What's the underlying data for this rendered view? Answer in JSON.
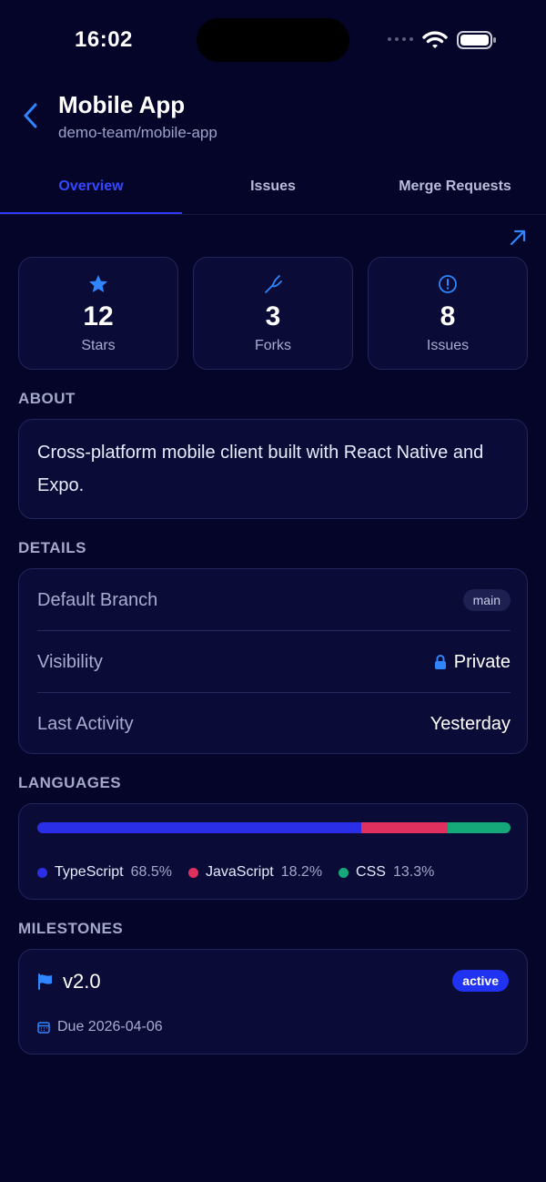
{
  "status_bar": {
    "time": "16:02"
  },
  "header": {
    "title": "Mobile App",
    "subtitle": "demo-team/mobile-app",
    "back_icon": "chevron-left-icon"
  },
  "tabs": [
    {
      "label": "Overview",
      "active": true
    },
    {
      "label": "Issues",
      "active": false
    },
    {
      "label": "Merge Requests",
      "active": false
    }
  ],
  "stats": [
    {
      "icon": "star-icon",
      "value": "12",
      "label": "Stars"
    },
    {
      "icon": "fork-icon",
      "value": "3",
      "label": "Forks"
    },
    {
      "icon": "issue-icon",
      "value": "8",
      "label": "Issues"
    }
  ],
  "about": {
    "heading": "ABOUT",
    "text": "Cross-platform mobile client built with React Native and Expo."
  },
  "details": {
    "heading": "DETAILS",
    "rows": [
      {
        "key": "Default Branch",
        "value": "main"
      },
      {
        "key": "Visibility",
        "value": "Private"
      },
      {
        "key": "Last Activity",
        "value": "Yesterday"
      }
    ]
  },
  "languages": {
    "heading": "LANGUAGES",
    "items": [
      {
        "name": "TypeScript",
        "percent": "68.5%",
        "color": "#2a2ee6"
      },
      {
        "name": "JavaScript",
        "percent": "18.2%",
        "color": "#e0305e"
      },
      {
        "name": "CSS",
        "percent": "13.3%",
        "color": "#15a97a"
      }
    ]
  },
  "milestones": {
    "heading": "MILESTONES",
    "items": [
      {
        "title": "v2.0",
        "status": "active",
        "due": "Due 2026-04-06"
      }
    ]
  },
  "colors": {
    "accent": "#2f3cff",
    "background": "#05052a",
    "card": "#0a0b36",
    "icon_blue": "#2f86ff"
  }
}
